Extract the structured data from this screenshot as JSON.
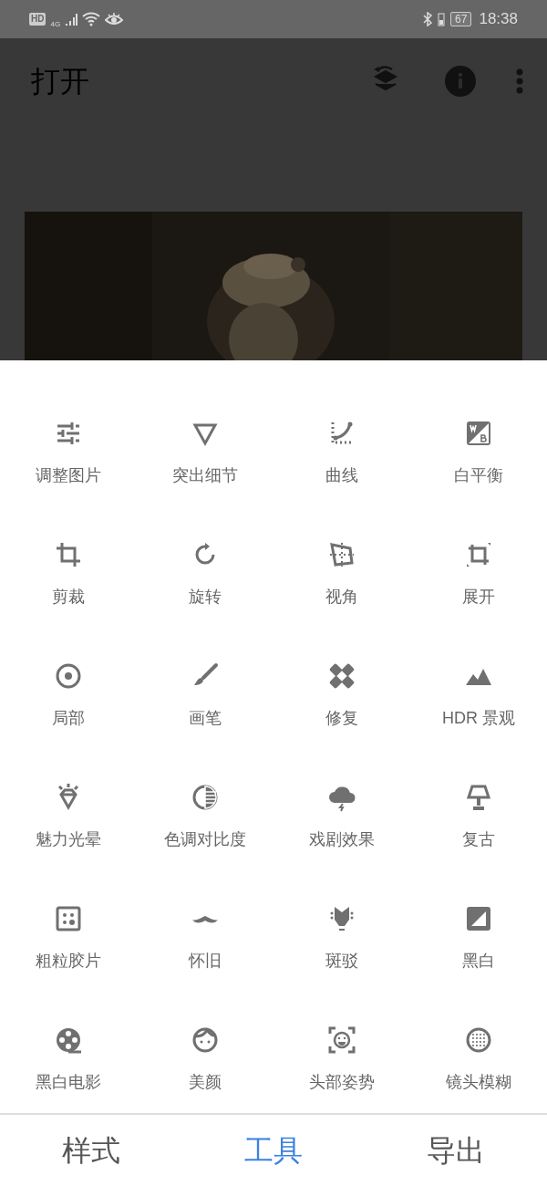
{
  "status_bar": {
    "hd": "HD",
    "network": "4G",
    "battery": "67",
    "time": "18:38"
  },
  "app_bar": {
    "title": "打开"
  },
  "tools": [
    {
      "label": "调整图片"
    },
    {
      "label": "突出细节"
    },
    {
      "label": "曲线"
    },
    {
      "label": "白平衡"
    },
    {
      "label": "剪裁"
    },
    {
      "label": "旋转"
    },
    {
      "label": "视角"
    },
    {
      "label": "展开"
    },
    {
      "label": "局部"
    },
    {
      "label": "画笔"
    },
    {
      "label": "修复"
    },
    {
      "label": "HDR 景观"
    },
    {
      "label": "魅力光晕"
    },
    {
      "label": "色调对比度"
    },
    {
      "label": "戏剧效果"
    },
    {
      "label": "复古"
    },
    {
      "label": "粗粒胶片"
    },
    {
      "label": "怀旧"
    },
    {
      "label": "斑驳"
    },
    {
      "label": "黑白"
    },
    {
      "label": "黑白电影"
    },
    {
      "label": "美颜"
    },
    {
      "label": "头部姿势"
    },
    {
      "label": "镜头模糊"
    }
  ],
  "bottom_tabs": [
    {
      "label": "样式",
      "selected": false
    },
    {
      "label": "工具",
      "selected": true
    },
    {
      "label": "导出",
      "selected": false
    }
  ]
}
